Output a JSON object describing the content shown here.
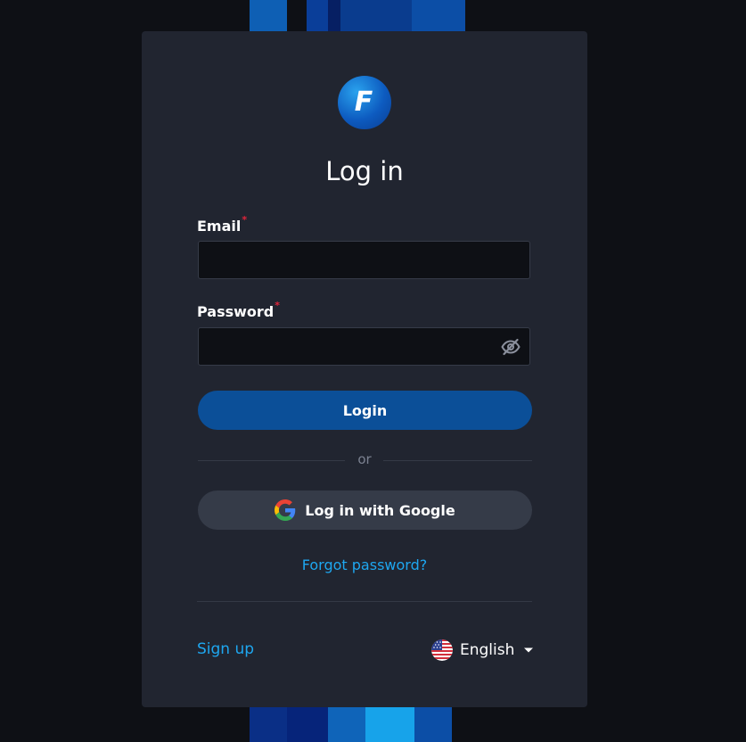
{
  "login": {
    "title": "Log in",
    "logo_letter": "F",
    "email": {
      "label": "Email",
      "required_mark": "*",
      "value": "",
      "placeholder": ""
    },
    "password": {
      "label": "Password",
      "required_mark": "*",
      "value": "",
      "placeholder": "",
      "visibility_icon": "eye-slash-icon"
    },
    "login_button": "Login",
    "or_text": "or",
    "google_button": "Log in with Google",
    "forgot_password": "Forgot password?",
    "signup": "Sign up",
    "language": {
      "selected": "English",
      "flag_icon": "us-flag-icon"
    }
  },
  "colors": {
    "accent_link": "#1ea7f0",
    "primary_button": "#0b4f98",
    "card_bg": "#212530",
    "page_bg": "#0e1015",
    "required": "#e0243a"
  }
}
